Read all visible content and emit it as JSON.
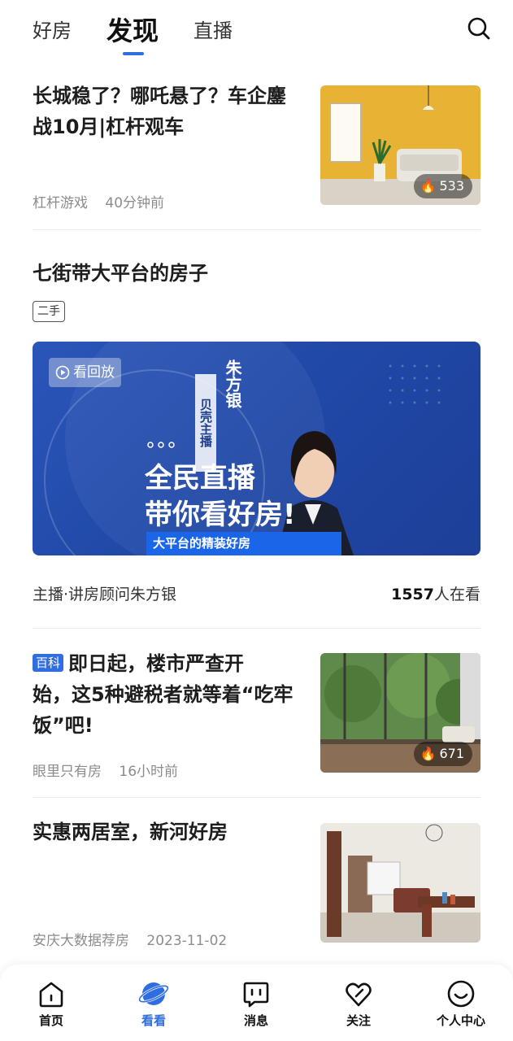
{
  "top_tabs": [
    {
      "label": "好房"
    },
    {
      "label": "发现"
    },
    {
      "label": "直播"
    }
  ],
  "active_tab": "发现",
  "icons": {
    "search": "search-icon",
    "heat": "flame-icon",
    "replay": "play-circle-icon"
  },
  "colors": {
    "accent": "#2f6ee0",
    "banner": "#2049a8"
  },
  "feed": {
    "article1": {
      "title_line1": "长城稳了？哪吒悬了？车企鏖",
      "title_line2": "战10月|杠杆观车",
      "source": "杠杆游戏",
      "time": "40分钟前",
      "heat": "533"
    },
    "live": {
      "title": "七街带大平台的房子",
      "tag": "二手",
      "replay_label": "看回放",
      "host_badge": "贝壳主播",
      "host_short": "朱方银",
      "banner_line1": "全民直播",
      "banner_line2": "带你看好房!",
      "banner_sub": "大平台的精装好房",
      "host": "主播·讲房顾问朱方银",
      "watch_count": "1557",
      "watch_suffix": "人在看"
    },
    "article2": {
      "badge": "百科",
      "title_line1": "即日起，楼市严查开",
      "title_line2": "始，这5种避税者就等着“吃牢",
      "title_line3": "饭”吧!",
      "source": "眼里只有房",
      "time": "16小时前",
      "heat": "671"
    },
    "article3": {
      "title": "实惠两居室，新河好房",
      "source": "安庆大数据荐房",
      "time": "2023-11-02"
    }
  },
  "bottom_nav": [
    {
      "label": "首页",
      "icon": "home-icon"
    },
    {
      "label": "看看",
      "icon": "planet-icon"
    },
    {
      "label": "消息",
      "icon": "message-icon"
    },
    {
      "label": "关注",
      "icon": "heart-icon"
    },
    {
      "label": "个人中心",
      "icon": "smiley-icon"
    }
  ],
  "active_nav": "看看"
}
